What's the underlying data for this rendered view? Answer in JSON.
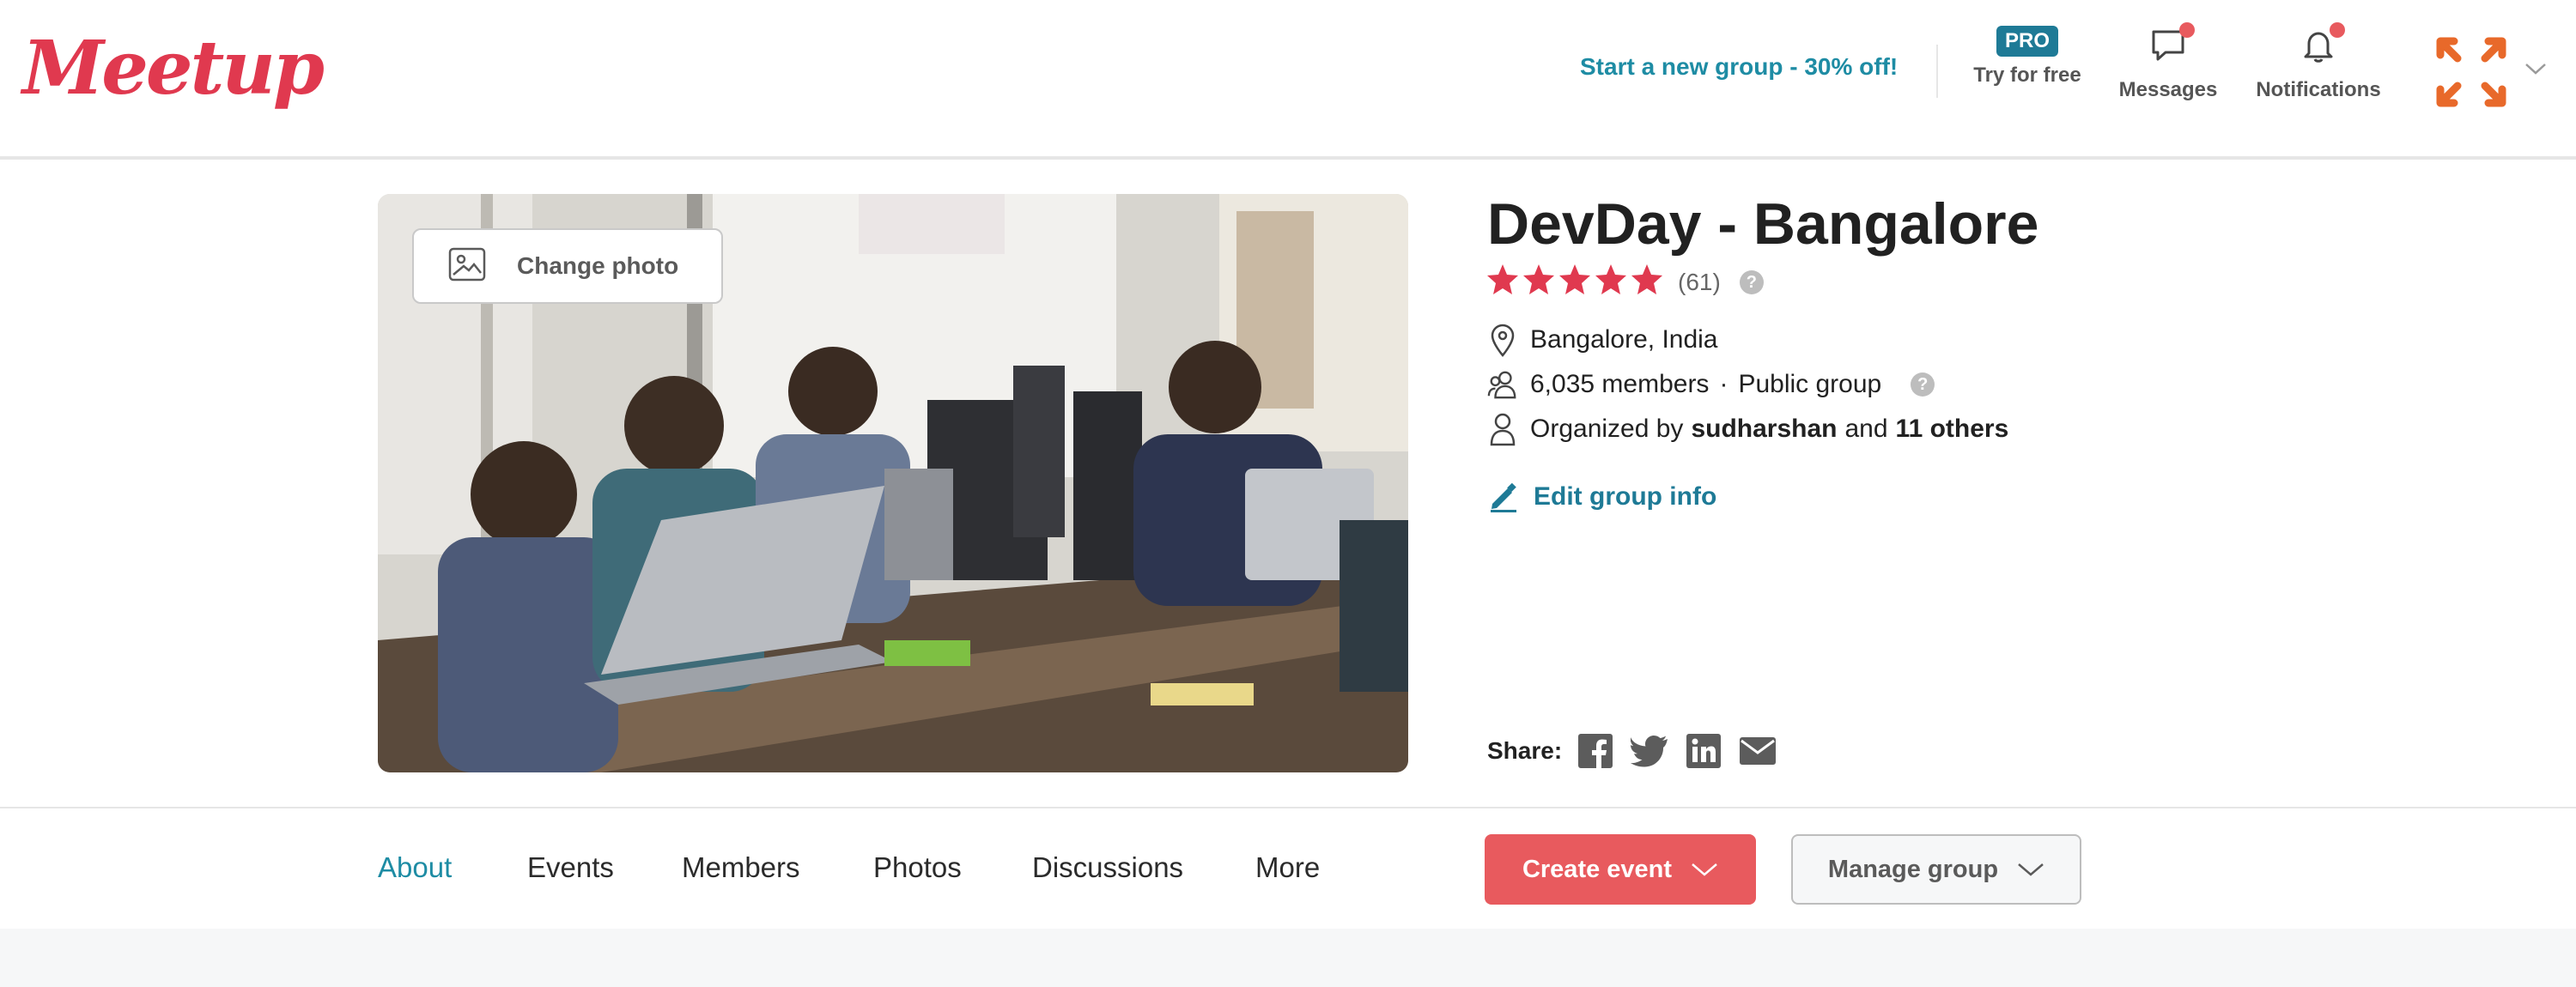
{
  "header": {
    "logo_text": "Meetup",
    "promo_link": "Start a new group - 30% off!",
    "pro_badge": "PRO",
    "try_label": "Try for free",
    "messages_label": "Messages",
    "notifications_label": "Notifications",
    "messages_has_unread": true,
    "notifications_has_unread": true
  },
  "hero": {
    "change_photo_label": "Change photo",
    "title": "DevDay - Bangalore",
    "rating": 4.5,
    "rating_count": "(61)",
    "location": "Bangalore, India",
    "members": "6,035 members",
    "separator": "·",
    "group_type": "Public group",
    "organized_prefix": "Organized by",
    "organizer": "sudharshan",
    "organized_and": "and",
    "others": "11 others",
    "edit_label": "Edit group info",
    "share_label": "Share:",
    "help_glyph": "?"
  },
  "tabs": [
    {
      "label": "About",
      "active": true
    },
    {
      "label": "Events",
      "active": false
    },
    {
      "label": "Members",
      "active": false
    },
    {
      "label": "Photos",
      "active": false
    },
    {
      "label": "Discussions",
      "active": false
    },
    {
      "label": "More",
      "active": false
    }
  ],
  "actions": {
    "create_event": "Create event",
    "manage_group": "Manage group"
  },
  "colors": {
    "brand_red": "#e0394f",
    "accent_teal": "#1e8ca4",
    "button_red": "#e85a5e",
    "star_red": "#e0394f",
    "avatar_orange": "#e8692a"
  },
  "icons": [
    "image-icon",
    "message-icon",
    "bell-icon",
    "location-pin-icon",
    "members-icon",
    "person-icon",
    "pencil-icon",
    "facebook-icon",
    "twitter-icon",
    "linkedin-icon",
    "email-icon",
    "chevron-down-icon"
  ]
}
